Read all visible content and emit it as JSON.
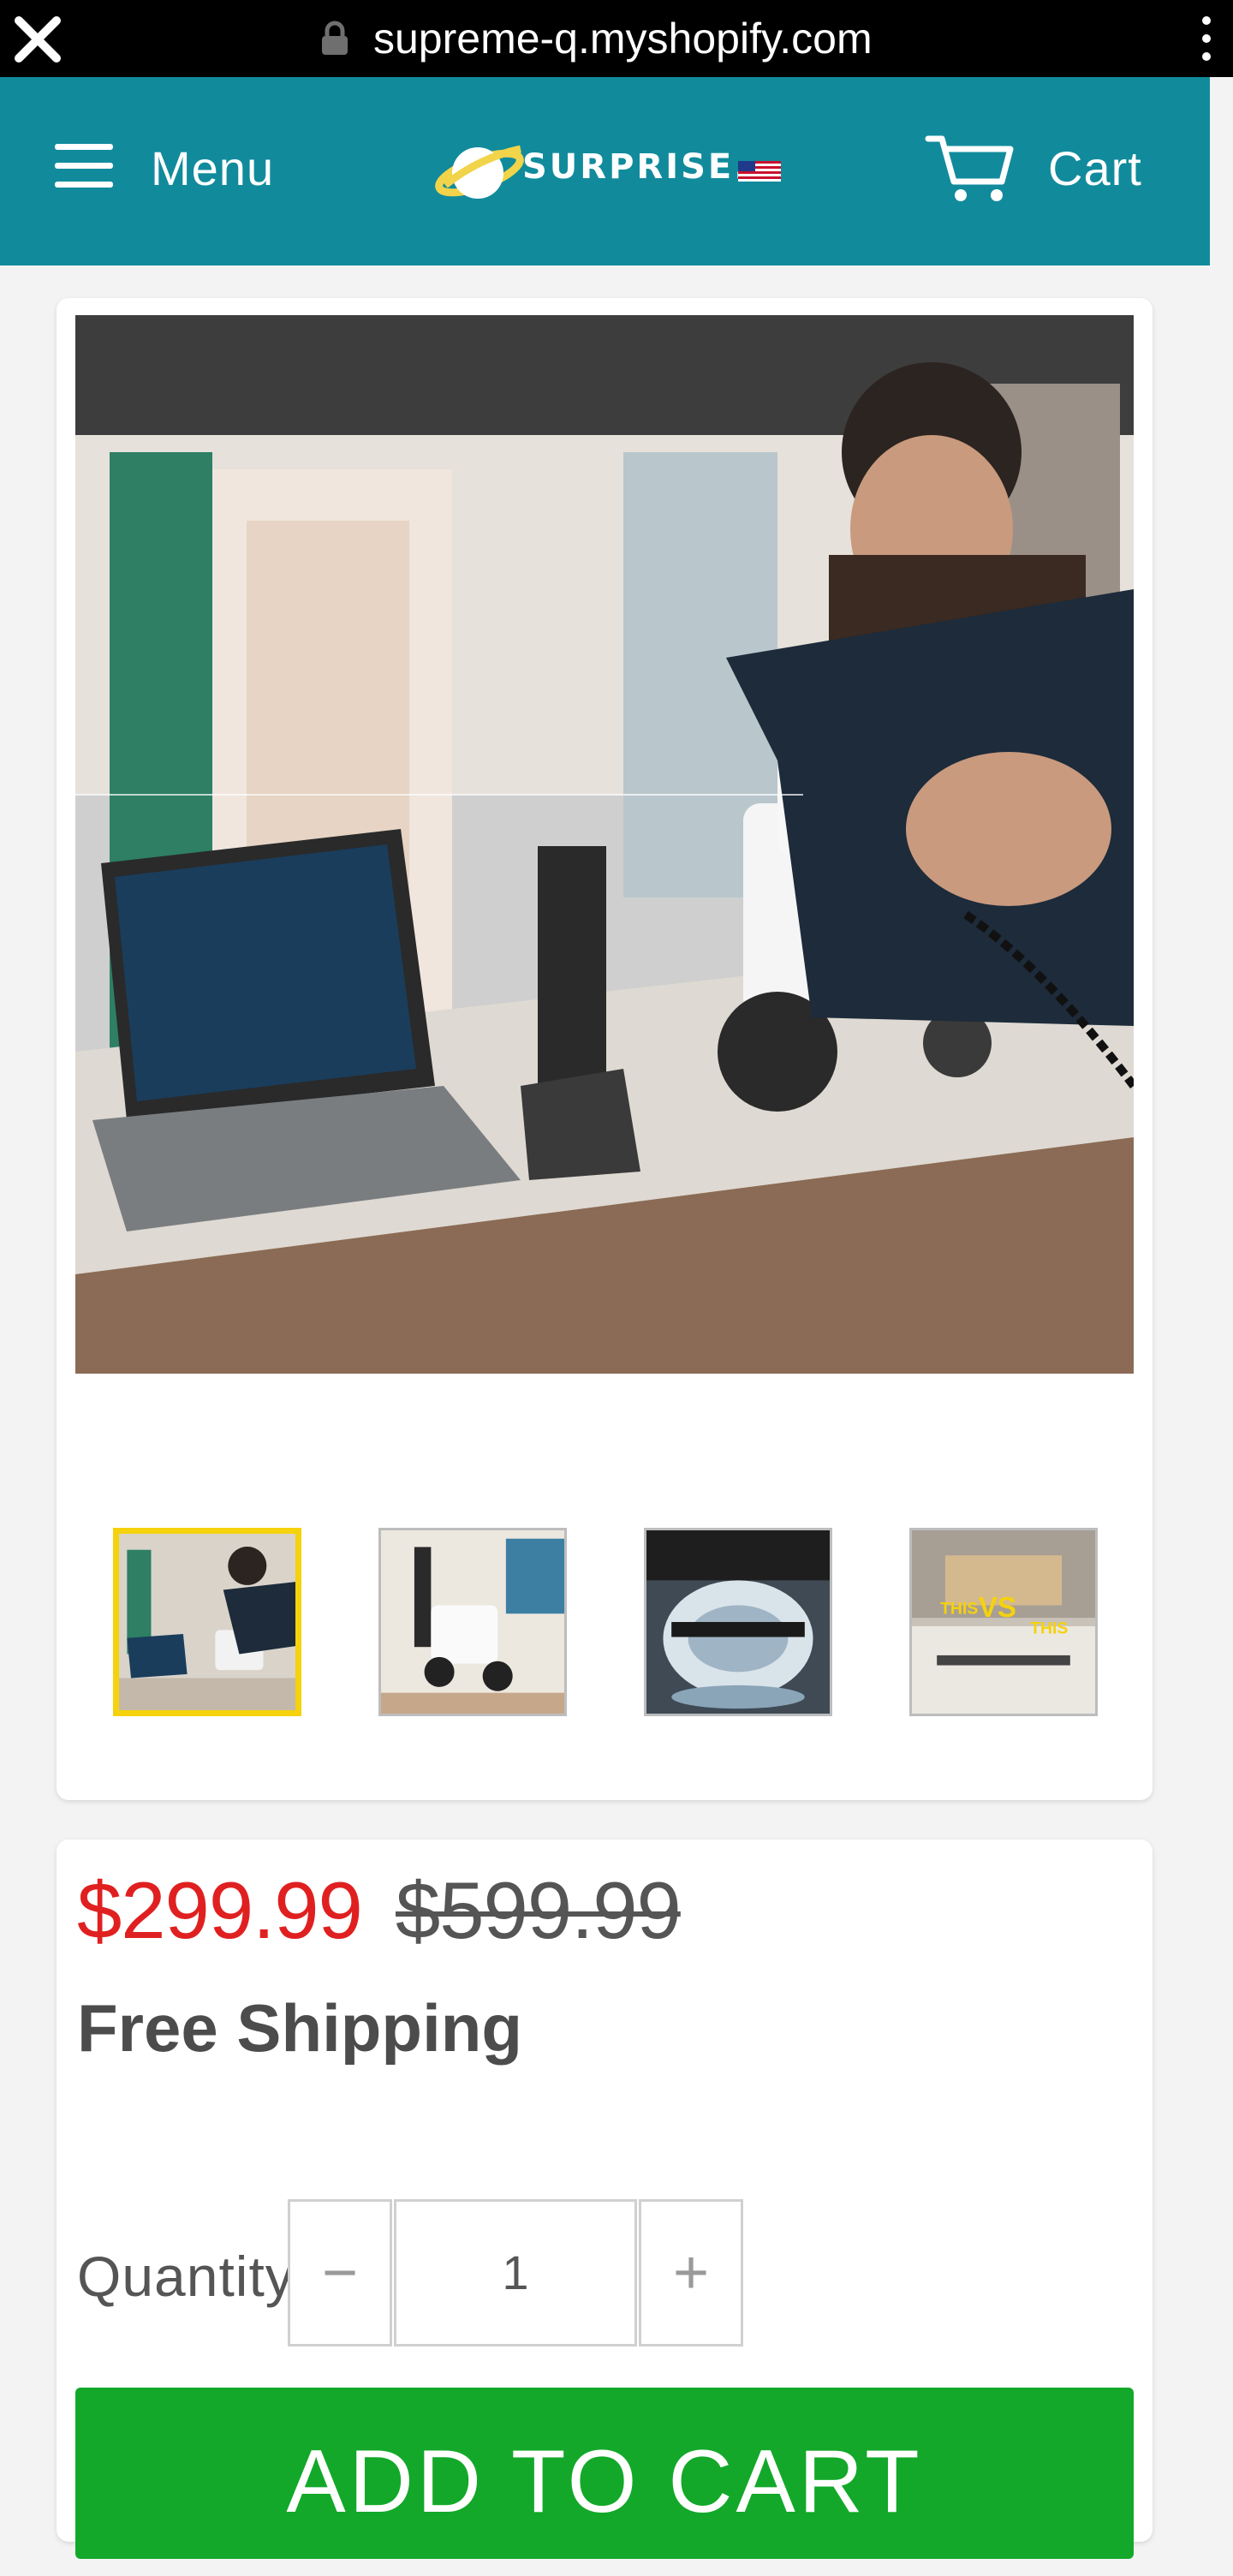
{
  "browser": {
    "url": "supreme-q.myshopify.com",
    "icons": [
      "close-icon",
      "lock-icon",
      "kebab-menu-icon"
    ]
  },
  "header": {
    "background": "#118b9c",
    "menu_label": "Menu",
    "logo_text": "SURPRISE.",
    "cart_label": "Cart"
  },
  "gallery": {
    "thumbnails": [
      {
        "caption": "",
        "active": true
      },
      {
        "caption": "",
        "active": false
      },
      {
        "caption": "",
        "active": false
      },
      {
        "caption": "THIS VS THIS",
        "active": false
      }
    ],
    "thumb4_words": {
      "left": "THIS",
      "mid": "VS",
      "right": "THIS"
    }
  },
  "product": {
    "price": "$299.99",
    "compare_price": "$599.99",
    "shipping": "Free Shipping",
    "quantity_label": "Quantity",
    "quantity_value": "1",
    "minus_glyph": "−",
    "plus_glyph": "+",
    "add_to_cart": "ADD TO CART",
    "colors": {
      "price": "#e02020",
      "button": "#13a829",
      "thumb_active_border": "#f5d20c"
    }
  }
}
